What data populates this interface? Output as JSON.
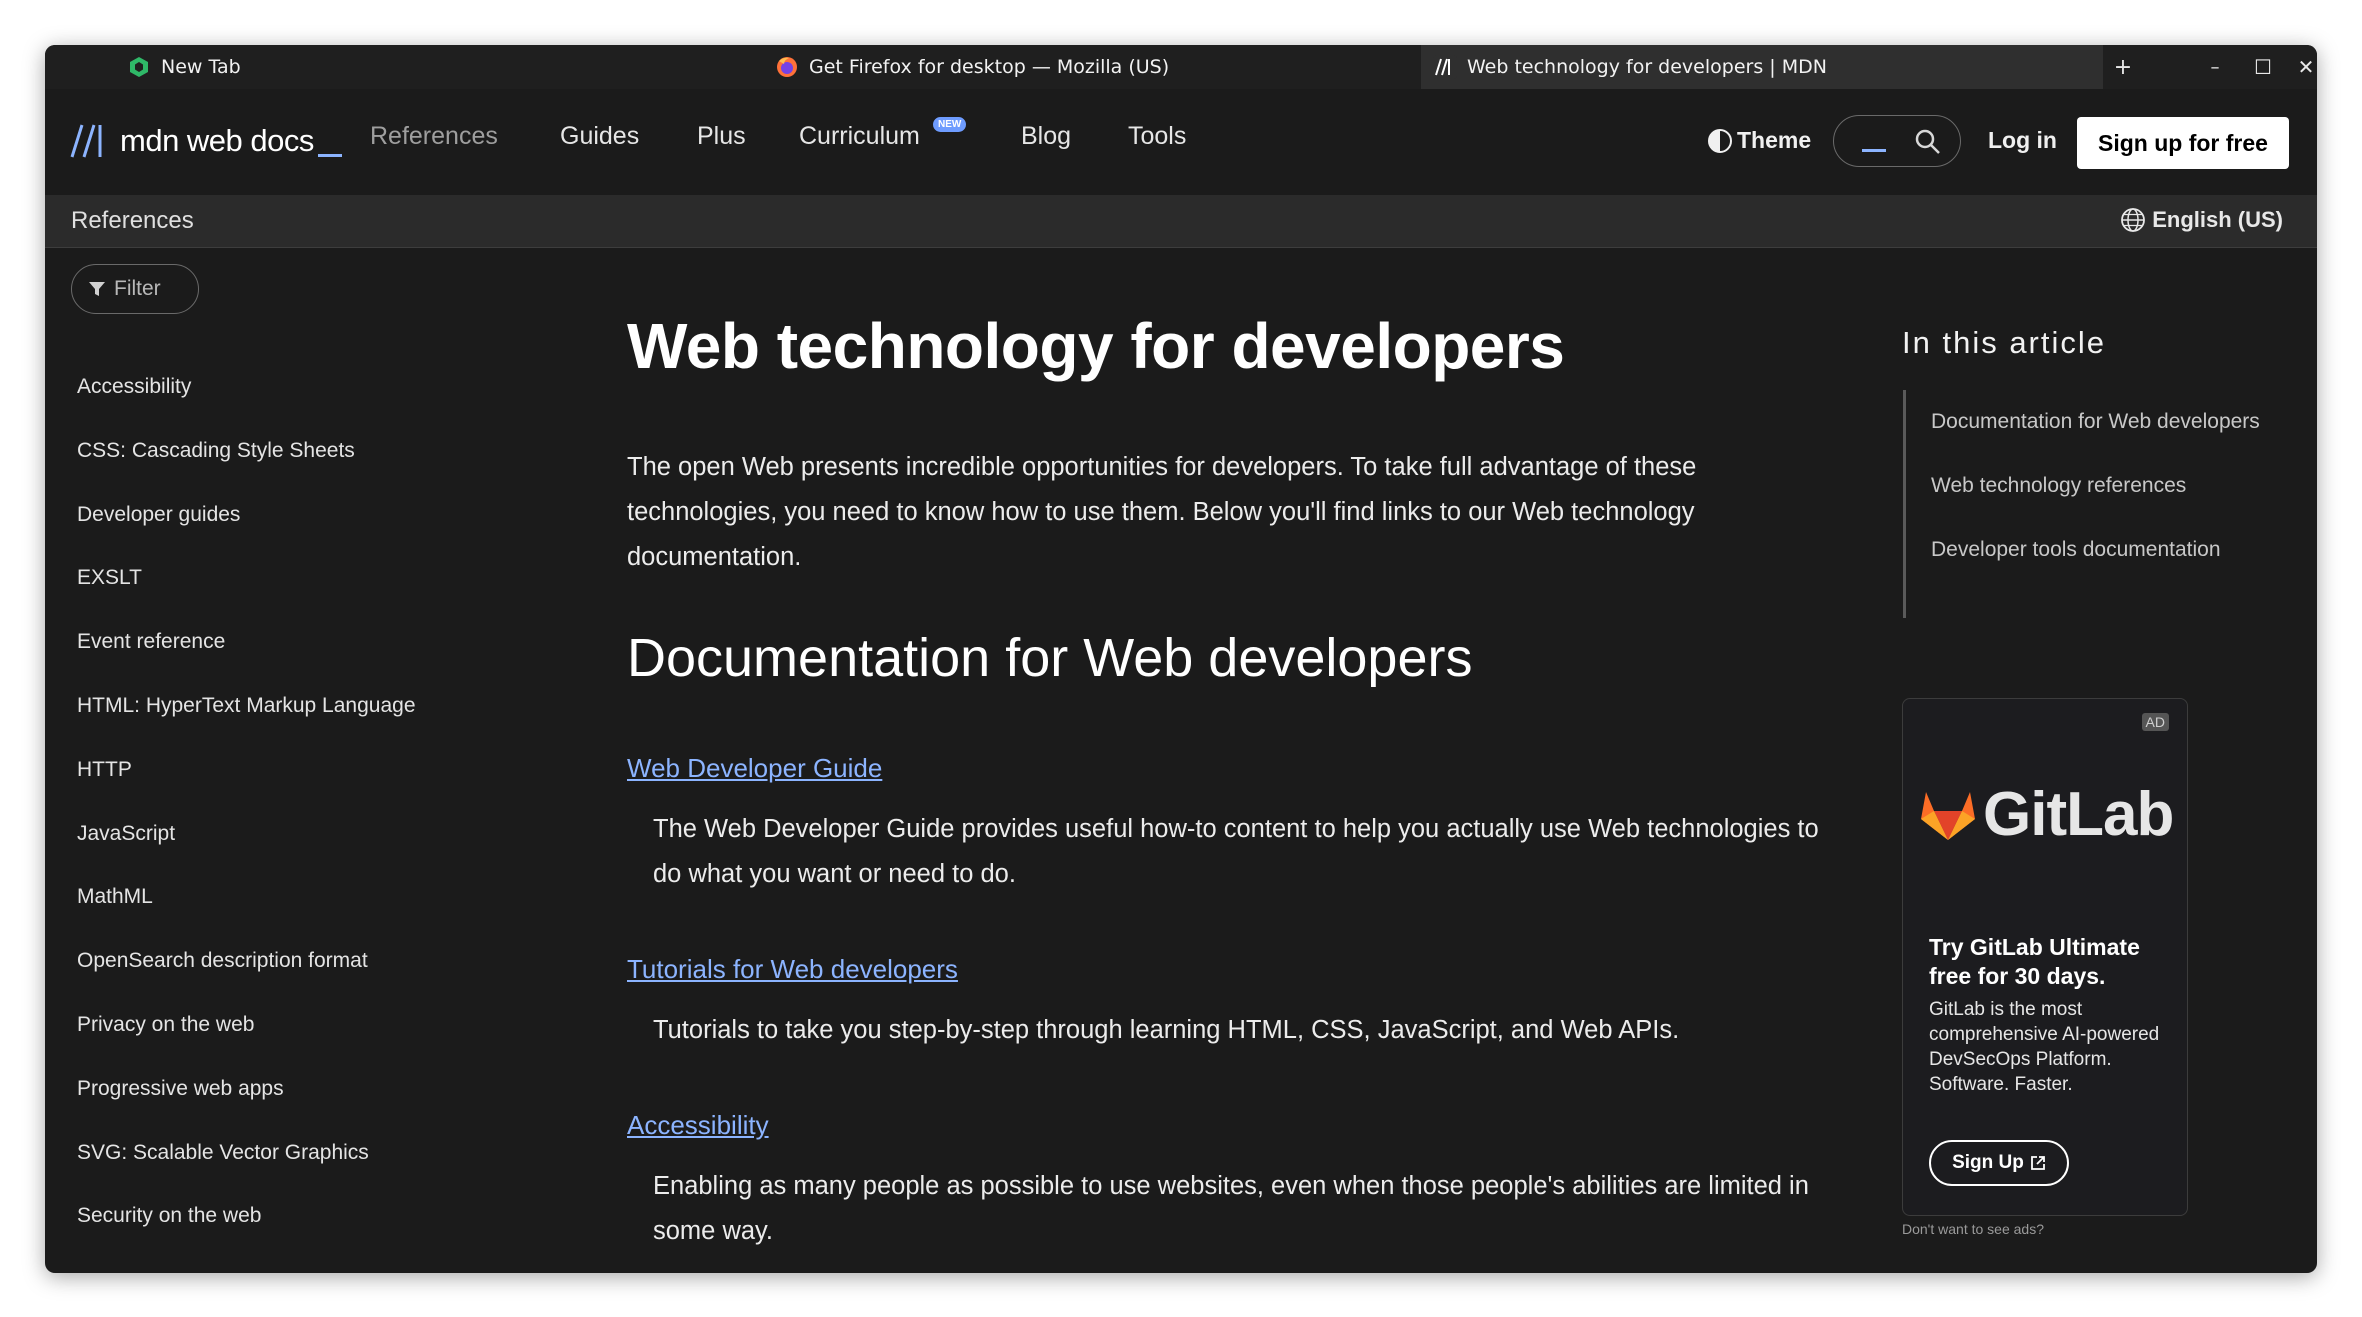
{
  "browser": {
    "tabs": [
      {
        "label": "New Tab",
        "icon": "new-tab-icon"
      },
      {
        "label": "Get Firefox for desktop — Mozilla (US)",
        "icon": "firefox-icon"
      },
      {
        "label": "Web technology for developers | MDN",
        "icon": "mdn-icon",
        "active": true
      }
    ],
    "new_tab_label": "+",
    "controls": {
      "minimize": "–",
      "maximize": "☐",
      "close": "✕"
    }
  },
  "header": {
    "logo_text": "mdn web docs",
    "nav": [
      {
        "label": "References"
      },
      {
        "label": "Guides"
      },
      {
        "label": "Plus"
      },
      {
        "label": "Curriculum",
        "badge": "NEW"
      },
      {
        "label": "Blog"
      },
      {
        "label": "Tools"
      }
    ],
    "theme_label": "Theme",
    "login_label": "Log in",
    "signup_label": "Sign up for free"
  },
  "breadcrumb": {
    "label": "References",
    "language": "English (US)"
  },
  "sidebar": {
    "filter_label": "Filter",
    "items": [
      "Accessibility",
      "CSS: Cascading Style Sheets",
      "Developer guides",
      "EXSLT",
      "Event reference",
      "HTML: HyperText Markup Language",
      "HTTP",
      "JavaScript",
      "MathML",
      "OpenSearch description format",
      "Privacy on the web",
      "Progressive web apps",
      "SVG: Scalable Vector Graphics",
      "Security on the web"
    ]
  },
  "article": {
    "title": "Web technology for developers",
    "intro": "The open Web presents incredible opportunities for developers. To take full advantage of these technologies, you need to know how to use them. Below you'll find links to our Web technology documentation.",
    "section_heading": "Documentation for Web developers",
    "entries": [
      {
        "link": "Web Developer Guide",
        "description": "The Web Developer Guide provides useful how-to content to help you actually use Web technologies to do what you want or need to do."
      },
      {
        "link": "Tutorials for Web developers",
        "description": "Tutorials to take you step-by-step through learning HTML, CSS, JavaScript, and Web APIs."
      },
      {
        "link": "Accessibility",
        "description": "Enabling as many people as possible to use websites, even when those people's abilities are limited in some way."
      }
    ]
  },
  "toc": {
    "title": "In this article",
    "items": [
      "Documentation for Web developers",
      "Web technology references",
      "Developer tools documentation"
    ]
  },
  "ad": {
    "badge": "AD",
    "brand": "GitLab",
    "headline": "Try GitLab Ultimate free for 30 days.",
    "body": "GitLab is the most comprehensive AI-powered DevSecOps Platform. Software. Faster.",
    "cta": "Sign Up",
    "note": "Don't want to see ads?"
  },
  "colors": {
    "background": "#1b1b1b",
    "link": "#8cb4ff",
    "accent_badge": "#6e9cff",
    "gitlab_orange": "#e24329"
  }
}
